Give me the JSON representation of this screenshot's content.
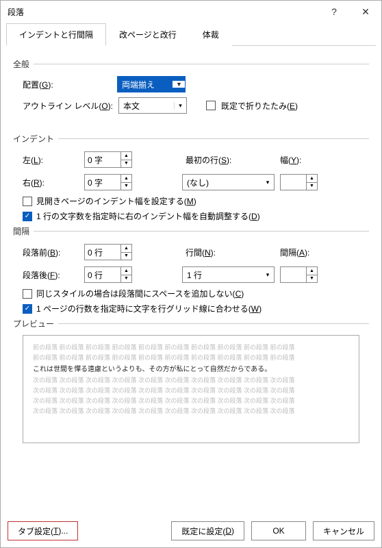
{
  "titlebar": {
    "title": "段落",
    "help": "?",
    "close": "✕"
  },
  "tabs": [
    "インデントと行間隔",
    "改ページと改行",
    "体裁"
  ],
  "general": {
    "legend": "全般",
    "alignment_label": "配置(G):",
    "alignment_value": "両端揃え",
    "outline_label": "アウトライン レベル(O):",
    "outline_value": "本文",
    "collapse_label": "既定で折りたたみ(E)"
  },
  "indent": {
    "legend": "インデント",
    "left_label": "左(L):",
    "left_value": "0 字",
    "right_label": "右(R):",
    "right_value": "0 字",
    "firstline_label": "最初の行(S):",
    "firstline_value": "(なし)",
    "width_label": "幅(Y):",
    "width_value": "",
    "mirror_label": "見開きページのインデント幅を設定する(M)",
    "auto_label": "1 行の文字数を指定時に右のインデント幅を自動調整する(D)"
  },
  "spacing": {
    "legend": "間隔",
    "before_label": "段落前(B):",
    "before_value": "0 行",
    "after_label": "段落後(F):",
    "after_value": "0 行",
    "linespace_label": "行間(N):",
    "linespace_value": "1 行",
    "at_label": "間隔(A):",
    "at_value": "",
    "nospace_label": "同じスタイルの場合は段落間にスペースを追加しない(C)",
    "snapgrid_label": "1 ページの行数を指定時に文字を行グリッド線に合わせる(W)"
  },
  "preview": {
    "legend": "プレビュー",
    "prev_repeat": "前の段落 前の段落 前の段落 前の段落 前の段落 前の段落 前の段落 前の段落 前の段落 前の段落",
    "sample": "これは世間を憚る遠慮というよりも、その方が私にとって自然だからである。",
    "next_repeat": "次の段落 次の段落 次の段落 次の段落 次の段落 次の段落 次の段落 次の段落 次の段落 次の段落"
  },
  "footer": {
    "tabs": "タブ設定(T)...",
    "default": "既定に設定(D)",
    "ok": "OK",
    "cancel": "キャンセル"
  }
}
